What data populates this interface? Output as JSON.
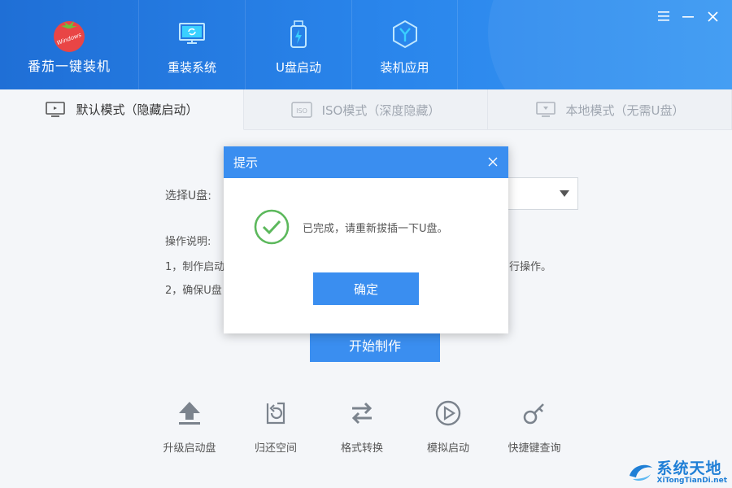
{
  "app": {
    "name": "番茄一键装机",
    "logo_text": "Windows"
  },
  "nav": [
    {
      "label": "重装系统",
      "icon": "monitor-refresh-icon"
    },
    {
      "label": "U盘启动",
      "icon": "usb-drive-icon"
    },
    {
      "label": "装机应用",
      "icon": "hexagon-y-icon"
    }
  ],
  "window_controls": [
    "menu-icon",
    "minimize-icon",
    "close-icon"
  ],
  "tabs": [
    {
      "label": "默认模式（隐藏启动）",
      "active": true,
      "icon": "monitor-icon"
    },
    {
      "label": "ISO模式（深度隐藏）",
      "active": false,
      "icon": "iso-icon"
    },
    {
      "label": "本地模式（无需U盘）",
      "active": false,
      "icon": "monitor-down-icon"
    }
  ],
  "main": {
    "select_label": "选择U盘:",
    "op_title": "操作说明:",
    "op_line1_start": "1，制作启动",
    "op_line1_end": "行操作。",
    "op_line2_start": "2，确保U盘",
    "start_label": "开始制作"
  },
  "tools": [
    {
      "label": "升级启动盘",
      "icon": "upload-arrow-icon"
    },
    {
      "label": "归还空间",
      "icon": "restore-space-icon"
    },
    {
      "label": "格式转换",
      "icon": "swap-arrows-icon"
    },
    {
      "label": "模拟启动",
      "icon": "play-circle-icon"
    },
    {
      "label": "快捷键查询",
      "icon": "key-icon"
    }
  ],
  "modal": {
    "title": "提示",
    "message": "已完成，请重新拔插一下U盘。",
    "ok_label": "确定"
  },
  "watermark": {
    "title": "系统天地",
    "url": "XiTongTianDi.net"
  },
  "colors": {
    "primary": "#3a8ef0",
    "header": "#2a86ec",
    "success": "#5cb85c"
  }
}
